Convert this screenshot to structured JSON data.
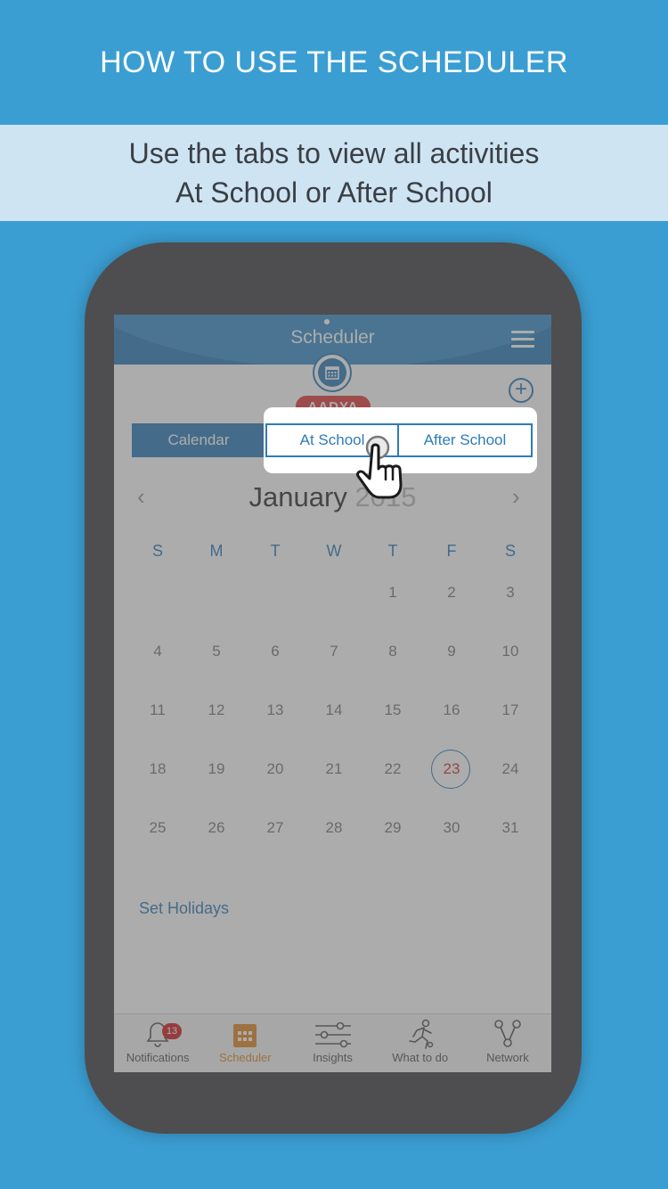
{
  "headline": "HOW TO USE THE SCHEDULER",
  "subtitle": {
    "line1": "Use the tabs to view all activities",
    "line2": "At School or After School"
  },
  "app": {
    "title": "Scheduler",
    "student_name": "AADYA",
    "tabs": [
      {
        "label": "Calendar"
      },
      {
        "label": "At School"
      },
      {
        "label": "After School"
      }
    ],
    "calendar": {
      "month": "January",
      "year": "2015",
      "weekdays": [
        "S",
        "M",
        "T",
        "W",
        "T",
        "F",
        "S"
      ],
      "weeks": [
        [
          "",
          "",
          "",
          "",
          "1",
          "2",
          "3"
        ],
        [
          "4",
          "5",
          "6",
          "7",
          "8",
          "9",
          "10"
        ],
        [
          "11",
          "12",
          "13",
          "14",
          "15",
          "16",
          "17"
        ],
        [
          "18",
          "19",
          "20",
          "21",
          "22",
          "23",
          "24"
        ],
        [
          "25",
          "26",
          "27",
          "28",
          "29",
          "30",
          "31"
        ]
      ],
      "today": "23"
    },
    "set_holidays": "Set Holidays",
    "bottom_nav": [
      {
        "label": "Notifications",
        "icon": "bell-icon",
        "badge": "13"
      },
      {
        "label": "Scheduler",
        "icon": "calendar-icon",
        "active": true
      },
      {
        "label": "Insights",
        "icon": "sliders-icon"
      },
      {
        "label": "What to do",
        "icon": "activity-person-icon"
      },
      {
        "label": "Network",
        "icon": "network-icon"
      }
    ]
  },
  "colors": {
    "background": "#3b9ed2",
    "accent": "#2e7cb8",
    "today": "#d0312d",
    "active_nav": "#e0892a",
    "student_pill": "#e13d3d"
  }
}
